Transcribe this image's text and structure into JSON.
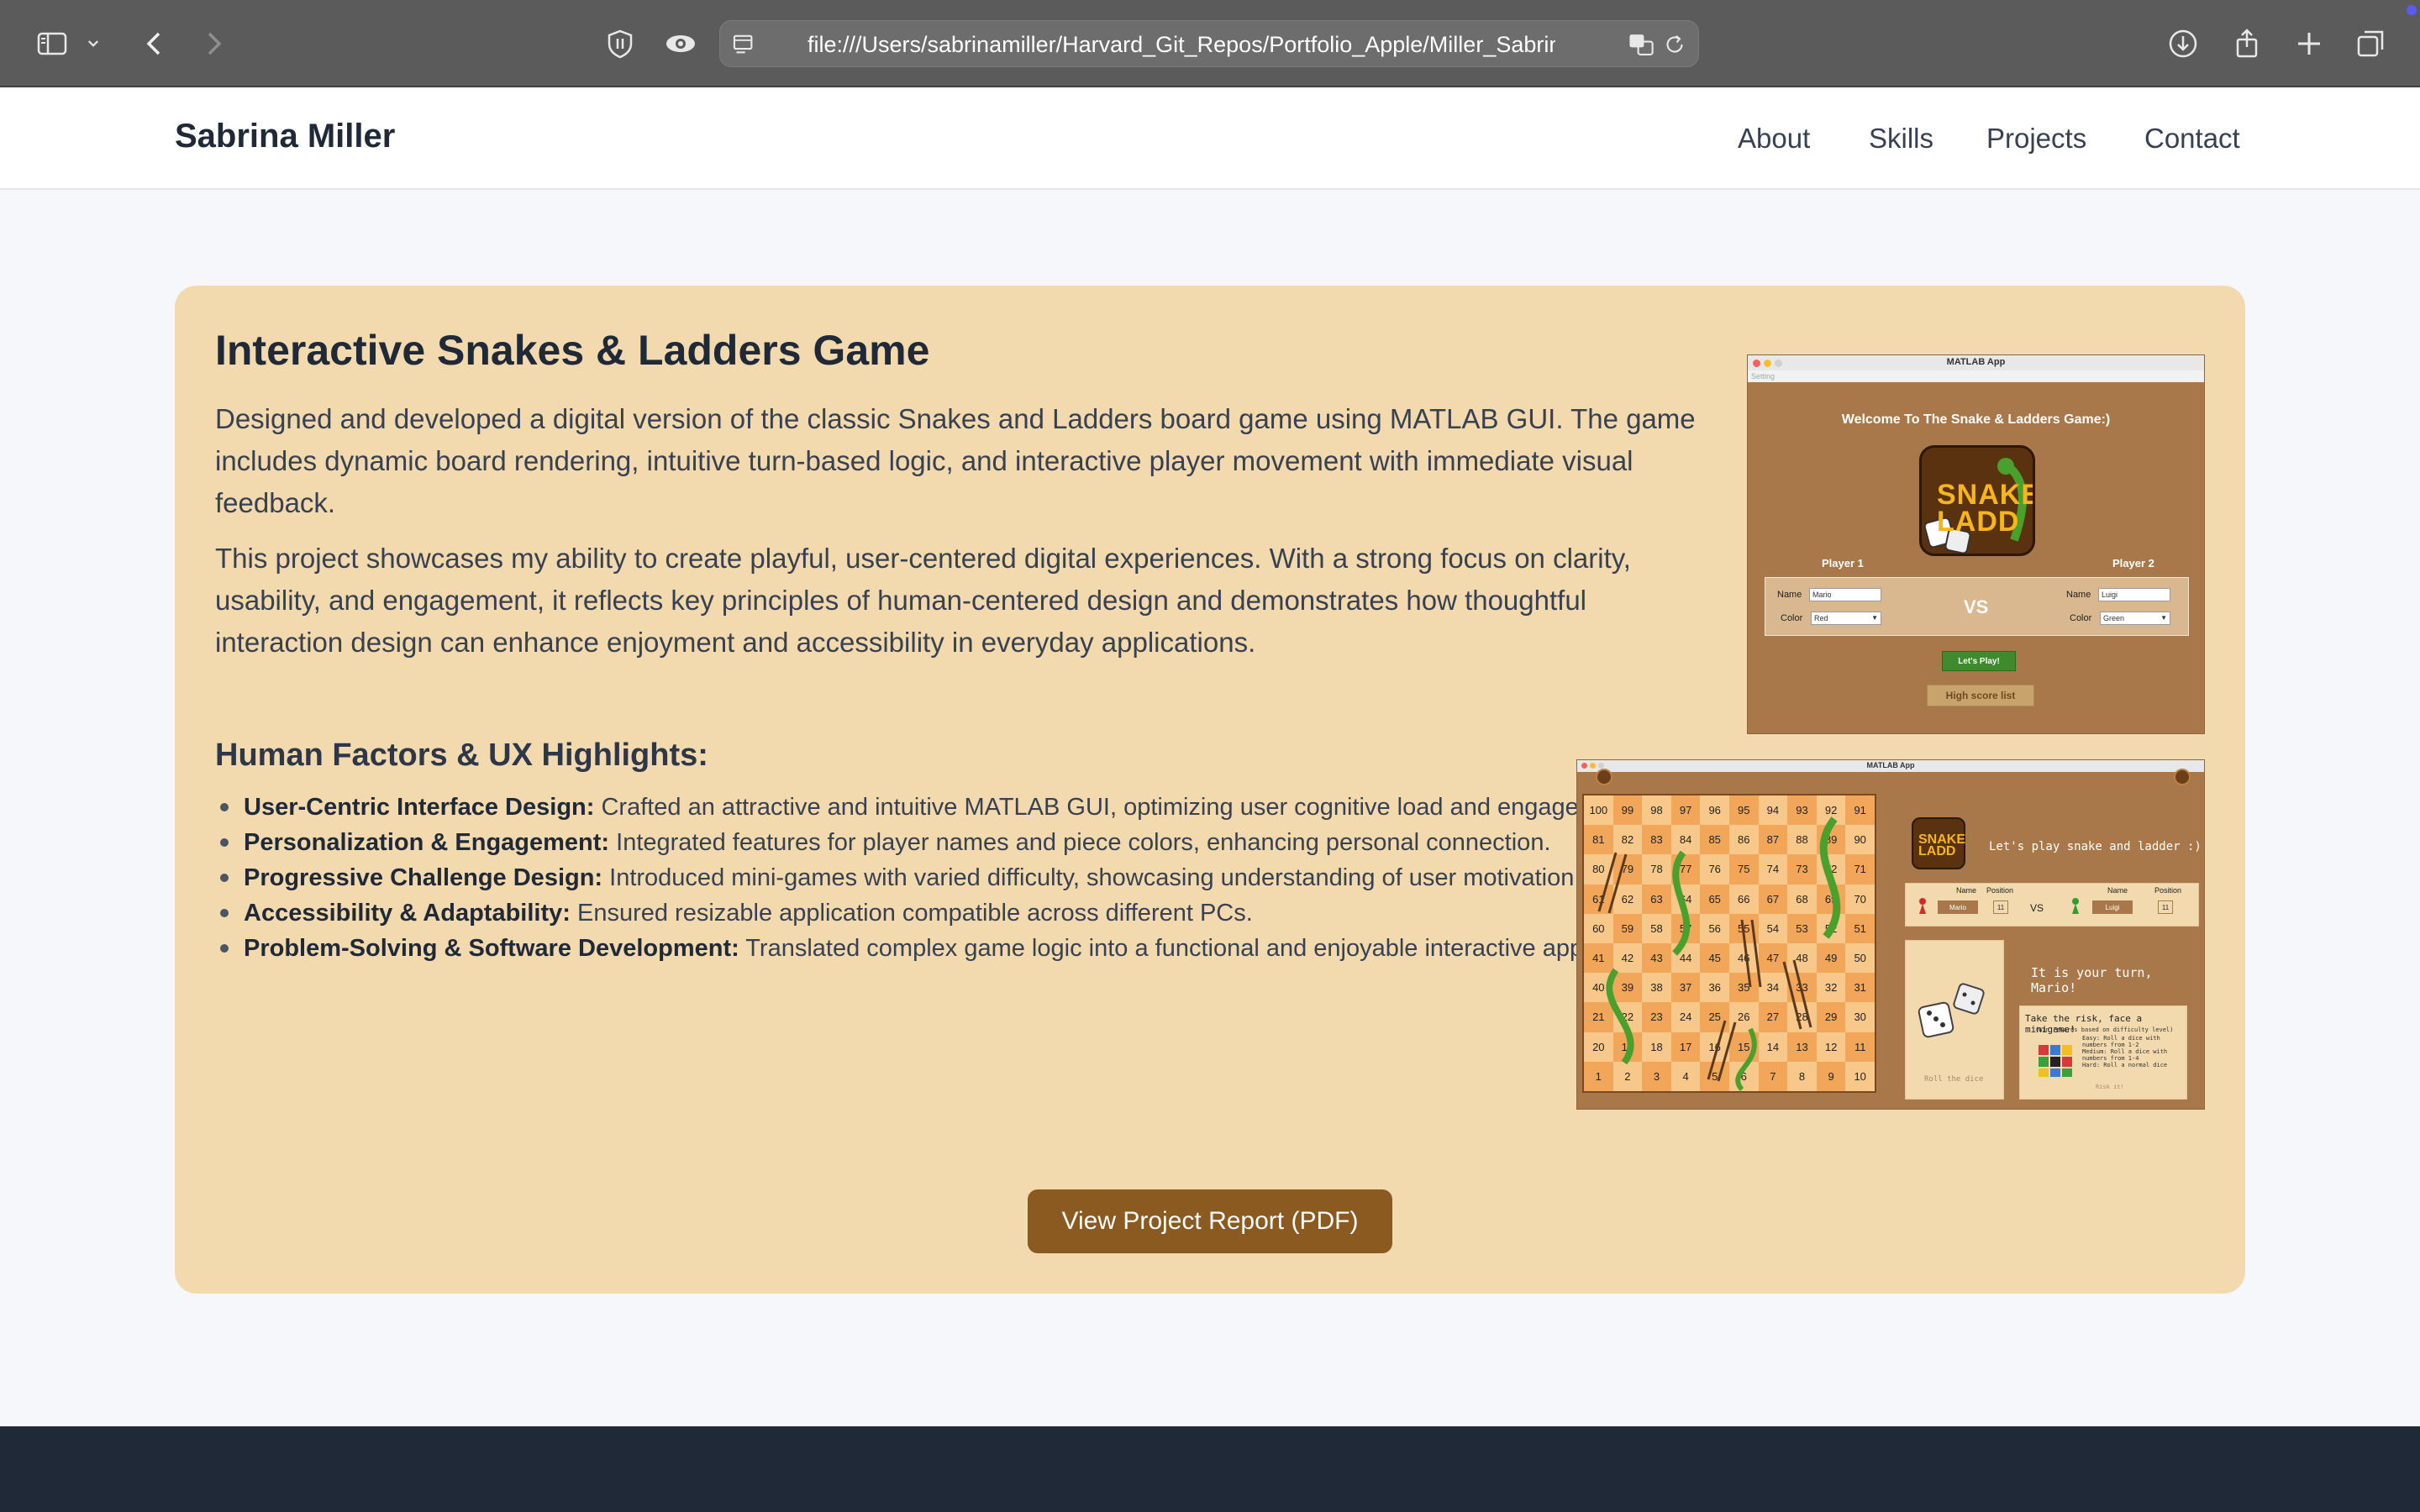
{
  "browser": {
    "url": "file:///Users/sabrinamiller/Harvard_Git_Repos/Portfolio_Apple/Miller_Sabrina_Po"
  },
  "nav": {
    "brand": "Sabrina Miller",
    "links": [
      "About",
      "Skills",
      "Projects",
      "Contact"
    ]
  },
  "project": {
    "title": "Interactive Snakes & Ladders Game",
    "paragraphs": [
      "Designed and developed a digital version of the classic Snakes and Ladders board game using MATLAB GUI. The game includes dynamic board rendering, intuitive turn-based logic, and interactive player movement with immediate visual feedback.",
      "This project showcases my ability to create playful, user-centered digital experiences. With a strong focus on clarity, usability, and engagement, it reflects key principles of human-centered design and demonstrates how thoughtful interaction design can enhance enjoyment and accessibility in everyday applications."
    ],
    "highlights_title": "Human Factors & UX Highlights:",
    "highlights": [
      {
        "label": "User-Centric Interface Design:",
        "text": " Crafted an attractive and intuitive MATLAB GUI, optimizing user cognitive load and engagement."
      },
      {
        "label": "Personalization & Engagement:",
        "text": " Integrated features for player names and piece colors, enhancing personal connection."
      },
      {
        "label": "Progressive Challenge Design:",
        "text": " Introduced mini-games with varied difficulty, showcasing understanding of user motivation."
      },
      {
        "label": "Accessibility & Adaptability:",
        "text": " Ensured resizable application compatible across different PCs."
      },
      {
        "label": "Problem-Solving & Software Development:",
        "text": " Translated complex game logic into a functional and enjoyable interactive application."
      }
    ],
    "button": "View Project Report (PDF)"
  },
  "screenshot1": {
    "window_title": "MATLAB App",
    "menu": "Setting",
    "welcome": "Welcome To The Snake & Ladders Game:)",
    "logo": "SNAKE LADD",
    "player1_label": "Player 1",
    "player2_label": "Player 2",
    "name_label": "Name",
    "color_label": "Color",
    "p1_name": "Mario",
    "p1_color": "Red",
    "p2_name": "Luigi",
    "p2_color": "Green",
    "vs": "VS",
    "play": "Let's Play!",
    "high_score": "High score list"
  },
  "screenshot2": {
    "window_title": "MATLAB App",
    "header": "Let's play snake and ladder :)",
    "logo": "SNAKE LADD",
    "name_label": "Name",
    "position_label": "Position",
    "p1_name": "Mario",
    "p1_pos": "11",
    "p2_name": "Luigi",
    "p2_pos": "11",
    "vs": "VS",
    "turn": "It is your turn, Mario!",
    "roll": "Roll the dice",
    "risk_title": "Take the risk, face a minigame!",
    "risk_lines": [
      "(Win rewards based on difficulty level)",
      "Easy: Roll a dice with",
      "numbers from 1-2",
      "Medium: Roll a dice with",
      "numbers from 1-4",
      "Hard: Roll a normal dice"
    ],
    "risk_btn": "Risk it!",
    "board": [
      [
        100,
        99,
        98,
        97,
        96,
        95,
        94,
        93,
        92,
        91
      ],
      [
        81,
        82,
        83,
        84,
        85,
        86,
        87,
        88,
        89,
        90
      ],
      [
        80,
        79,
        78,
        77,
        76,
        75,
        74,
        73,
        72,
        71
      ],
      [
        61,
        62,
        63,
        64,
        65,
        66,
        67,
        68,
        69,
        70
      ],
      [
        60,
        59,
        58,
        57,
        56,
        55,
        54,
        53,
        52,
        51
      ],
      [
        41,
        42,
        43,
        44,
        45,
        46,
        47,
        48,
        49,
        50
      ],
      [
        40,
        39,
        38,
        37,
        36,
        35,
        34,
        33,
        32,
        31
      ],
      [
        21,
        22,
        23,
        24,
        25,
        26,
        27,
        28,
        29,
        30
      ],
      [
        20,
        19,
        18,
        17,
        16,
        15,
        14,
        13,
        12,
        11
      ],
      [
        1,
        2,
        3,
        4,
        5,
        6,
        7,
        8,
        9,
        10
      ]
    ]
  }
}
